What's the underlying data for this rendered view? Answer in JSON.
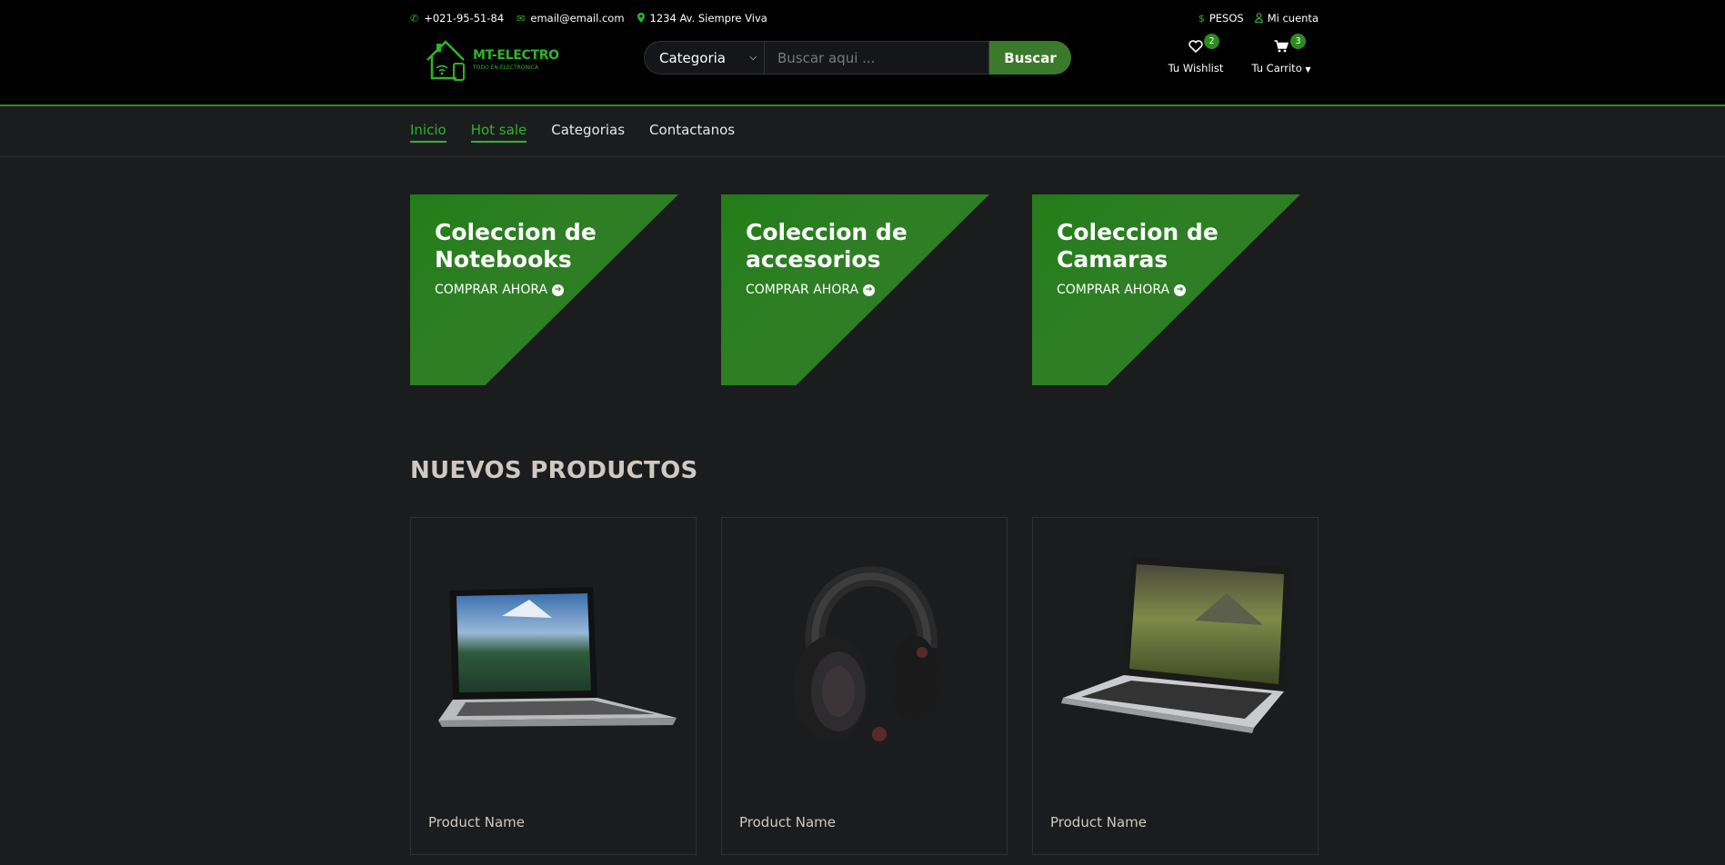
{
  "contact": {
    "phone": "+021-95-51-84",
    "email": "email@email.com",
    "address": "1234 Av. Siempre Viva"
  },
  "account": {
    "currency": "PESOS",
    "my_account": "Mi cuenta"
  },
  "logo": {
    "name": "MT-ELECTRO",
    "tagline": "TODO EN ELECTRONICA"
  },
  "search": {
    "category_label": "Categoria",
    "placeholder": "Buscar aqui ...",
    "button_label": "Buscar"
  },
  "wishlist": {
    "label": "Tu Wishlist",
    "count": "2"
  },
  "cart": {
    "label": "Tu Carrito",
    "count": "3"
  },
  "nav": {
    "items": [
      {
        "label": "Inicio",
        "active": true
      },
      {
        "label": "Hot sale",
        "active": true
      },
      {
        "label": "Categorias",
        "active": false
      },
      {
        "label": "Contactanos",
        "active": false
      }
    ]
  },
  "collections": [
    {
      "title": "Coleccion de Notebooks",
      "cta": "COMPRAR AHORA"
    },
    {
      "title": "Coleccion de accesorios",
      "cta": "COMPRAR AHORA"
    },
    {
      "title": "Coleccion de Camaras",
      "cta": "COMPRAR AHORA"
    }
  ],
  "new_products": {
    "title": "NUEVOS PRODUCTOS",
    "items": [
      {
        "name": "Product Name",
        "image": "laptop-macbook-image"
      },
      {
        "name": "Product Name",
        "image": "headphones-image"
      },
      {
        "name": "Product Name",
        "image": "laptop-landscape-image"
      }
    ]
  },
  "colors": {
    "accent_green": "#2fb42a",
    "button_green": "#3b7a2a",
    "banner_green": "#2b7a22",
    "header_bg": "#000000",
    "page_bg": "#1b1c1e"
  }
}
